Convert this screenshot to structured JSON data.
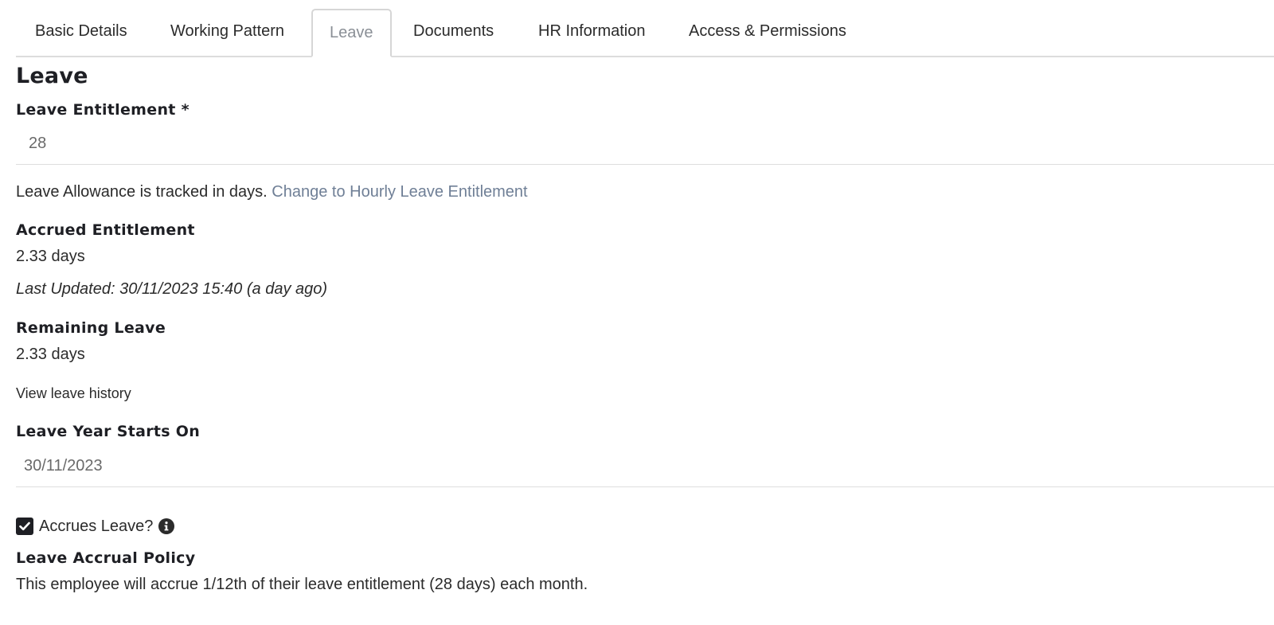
{
  "tabs": [
    {
      "label": "Basic Details",
      "active": false
    },
    {
      "label": "Working Pattern",
      "active": false
    },
    {
      "label": "Leave",
      "active": true
    },
    {
      "label": "Documents",
      "active": false
    },
    {
      "label": "HR Information",
      "active": false
    },
    {
      "label": "Access & Permissions",
      "active": false
    }
  ],
  "section": {
    "title": "Leave"
  },
  "leave_entitlement": {
    "label": "Leave Entitlement *",
    "value": "28"
  },
  "allowance_note": {
    "text": "Leave Allowance is tracked in days.",
    "link": "Change to Hourly Leave Entitlement"
  },
  "accrued": {
    "label": "Accrued Entitlement",
    "value": "2.33 days",
    "last_updated": "Last Updated: 30/11/2023 15:40 (a day ago)"
  },
  "remaining": {
    "label": "Remaining Leave",
    "value": "2.33 days"
  },
  "history_link": "View leave history",
  "leave_year": {
    "label": "Leave Year Starts On",
    "value": "30/11/2023"
  },
  "accrues": {
    "label": "Accrues Leave?",
    "checked": true,
    "info_icon": "info-icon"
  },
  "policy": {
    "label": "Leave Accrual Policy",
    "text": "This employee will accrue 1/12th of their leave entitlement (28 days) each month."
  },
  "colors": {
    "link": "#6f7f96",
    "heading": "#1e1f24",
    "text": "#2b2b2b",
    "border": "#dcdcdc"
  }
}
